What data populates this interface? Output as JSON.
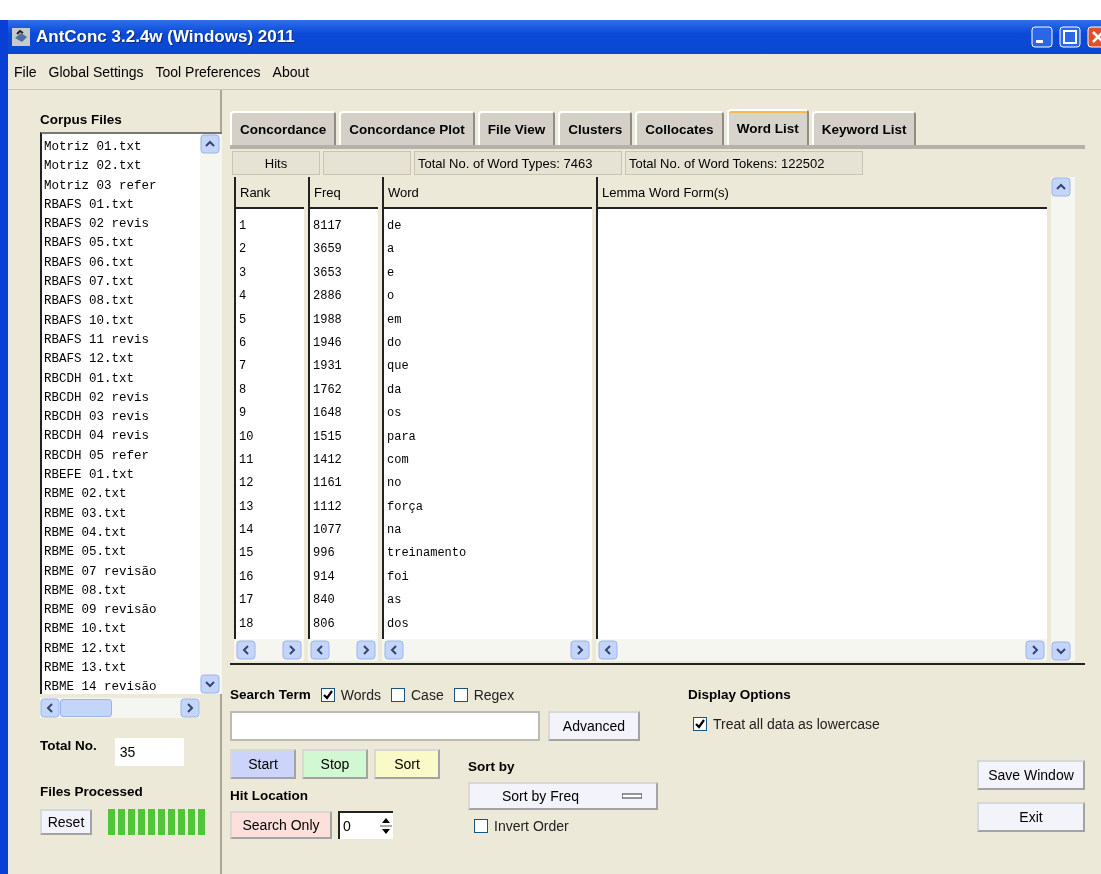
{
  "window": {
    "title": "AntConc 3.2.4w (Windows) 2011"
  },
  "menu": [
    "File",
    "Global Settings",
    "Tool Preferences",
    "About"
  ],
  "corpus_files": {
    "title": "Corpus Files",
    "items": [
      "Motriz 01.txt",
      "Motriz 02.txt",
      "Motriz 03 refer",
      "RBAFS 01.txt",
      "RBAFS 02 revis",
      "RBAFS 05.txt",
      "RBAFS 06.txt",
      "RBAFS 07.txt",
      "RBAFS 08.txt",
      "RBAFS 10.txt",
      "RBAFS 11 revis",
      "RBAFS 12.txt",
      "RBCDH 01.txt",
      "RBCDH 02 revis",
      "RBCDH 03 revis",
      "RBCDH 04 revis",
      "RBCDH 05 refer",
      "RBEFE 01.txt",
      "RBME 02.txt",
      "RBME 03.txt",
      "RBME 04.txt",
      "RBME 05.txt",
      "RBME 07 revisão",
      "RBME 08.txt",
      "RBME 09 revisão",
      "RBME 10.txt",
      "RBME 12.txt",
      "RBME 13.txt",
      "RBME 14 revisão"
    ]
  },
  "total": {
    "label": "Total No.",
    "value": "35"
  },
  "files_processed": {
    "label": "Files Processed",
    "level": 1
  },
  "reset_button": "Reset",
  "tabs": [
    {
      "label": "Concordance",
      "selected": false
    },
    {
      "label": "Concordance Plot",
      "selected": false
    },
    {
      "label": "File View",
      "selected": false
    },
    {
      "label": "Clusters",
      "selected": false
    },
    {
      "label": "Collocates",
      "selected": false
    },
    {
      "label": "Word List",
      "selected": true
    },
    {
      "label": "Keyword List",
      "selected": false
    }
  ],
  "summary": {
    "hits": "Hits",
    "word_types": "Total No. of Word Types: 7463",
    "word_tokens": "Total No. of Word Tokens: 122502"
  },
  "table": {
    "columns": [
      "Rank",
      "Freq",
      "Word",
      "Lemma Word Form(s)"
    ],
    "rows": [
      [
        "1",
        "8117",
        "de"
      ],
      [
        "2",
        "3659",
        "a"
      ],
      [
        "3",
        "3653",
        "e"
      ],
      [
        "4",
        "2886",
        "o"
      ],
      [
        "5",
        "1988",
        "em"
      ],
      [
        "6",
        "1946",
        "do"
      ],
      [
        "7",
        "1931",
        "que"
      ],
      [
        "8",
        "1762",
        "da"
      ],
      [
        "9",
        "1648",
        "os"
      ],
      [
        "10",
        "1515",
        "para"
      ],
      [
        "11",
        "1412",
        "com"
      ],
      [
        "12",
        "1161",
        "no"
      ],
      [
        "13",
        "1112",
        "força"
      ],
      [
        "14",
        "1077",
        "na"
      ],
      [
        "15",
        "996",
        "treinamento"
      ],
      [
        "16",
        "914",
        "foi"
      ],
      [
        "17",
        "840",
        "as"
      ],
      [
        "18",
        "806",
        "dos"
      ]
    ]
  },
  "search": {
    "label": "Search Term",
    "options": [
      {
        "label": "Words",
        "checked": true
      },
      {
        "label": "Case",
        "checked": false
      },
      {
        "label": "Regex",
        "checked": false
      }
    ],
    "advanced": "Advanced"
  },
  "actions": [
    {
      "label": "Start",
      "color": "#ccd5f9"
    },
    {
      "label": "Stop",
      "color": "#d2f8d2"
    },
    {
      "label": "Sort",
      "color": "#fafac8"
    }
  ],
  "hit_location": {
    "label": "Hit Location",
    "button": "Search Only",
    "value": "0"
  },
  "sort": {
    "label": "Sort by",
    "value": "Sort by Freq",
    "invert": {
      "label": "Invert Order",
      "checked": false
    }
  },
  "display_options": {
    "title": "Display Options",
    "lowercase": {
      "label": "Treat all data as lowercase",
      "checked": true
    }
  },
  "window_buttons": [
    "Save Window",
    "Exit"
  ]
}
